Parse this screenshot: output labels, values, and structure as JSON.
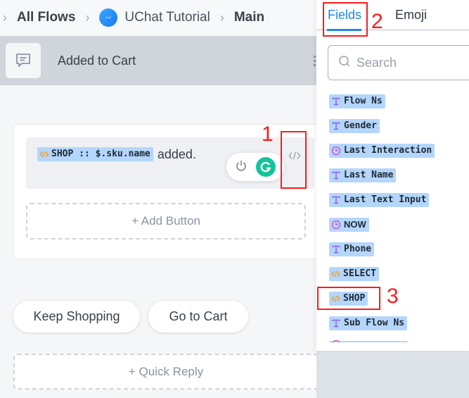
{
  "breadcrumb": {
    "items": [
      {
        "label": "All Flows",
        "style": "strong"
      },
      {
        "label": "UChat Tutorial",
        "style": "normal",
        "icon": "messenger-icon"
      },
      {
        "label": "Main",
        "style": "strong"
      }
    ],
    "separator": "›"
  },
  "node": {
    "title": "Added to Cart",
    "icon": "message-icon"
  },
  "message": {
    "chip_label": "SHOP :: $.sku.name",
    "chip_icon": "code-icon",
    "suffix_text": "added.",
    "code_button_label": "</>"
  },
  "buttons": {
    "add_button": "+ Add Button",
    "quick_replies": [
      "Keep Shopping",
      "Go to Cart"
    ],
    "add_quick_reply": "+ Quick Reply"
  },
  "panel": {
    "tabs": [
      {
        "label": "Fields",
        "active": true
      },
      {
        "label": "Emoji",
        "active": false
      }
    ],
    "search_placeholder": "Search",
    "fields": [
      {
        "label": "Flow Ns",
        "icon": "text-icon"
      },
      {
        "label": "Gender",
        "icon": "text-icon"
      },
      {
        "label": "Last Interaction",
        "icon": "clock-icon"
      },
      {
        "label": "Last Name",
        "icon": "text-icon"
      },
      {
        "label": "Last Text Input",
        "icon": "text-icon"
      },
      {
        "label": "NOW",
        "icon": "clock-icon"
      },
      {
        "label": "Phone",
        "icon": "text-icon"
      },
      {
        "label": "SELECT",
        "icon": "code-icon"
      },
      {
        "label": "SHOP",
        "icon": "code-icon"
      },
      {
        "label": "Sub Flow Ns",
        "icon": "text-icon"
      },
      {
        "label": "",
        "icon": "clock-icon"
      }
    ]
  },
  "annotations": [
    "1",
    "2",
    "3"
  ],
  "colors": {
    "accent": "#1e88e5",
    "chip_bg": "#b4d6fb",
    "annotation": "#ff1a1a",
    "grammarly": "#15c39a"
  }
}
